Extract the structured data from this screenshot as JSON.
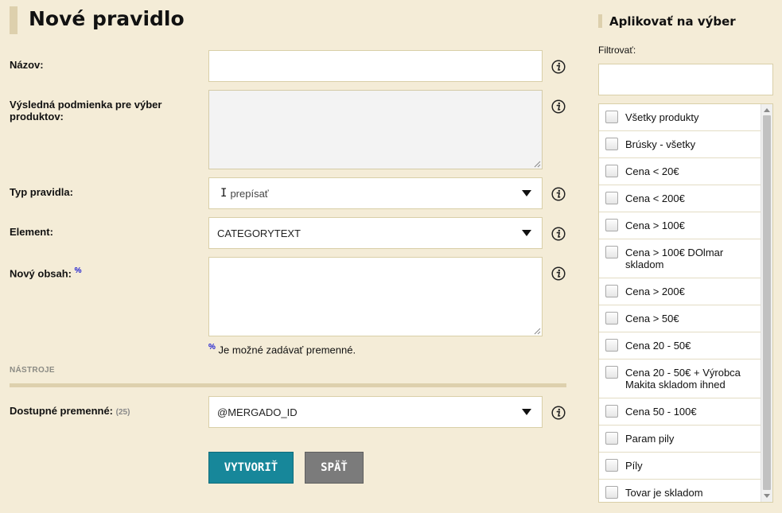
{
  "page": {
    "title": "Nové pravidlo"
  },
  "form": {
    "name_label": "Názov:",
    "condition_label": "Výsledná podmienka pre výber produktov:",
    "type_label": "Typ pravidla:",
    "type_value": "prepísať",
    "element_label": "Element:",
    "element_value": "CATEGORYTEXT",
    "content_label": "Nový obsah:",
    "content_marker": "%",
    "hint_marker": "%",
    "hint_text": "Je možné zadávať premenné.",
    "name_value": "",
    "content_value": ""
  },
  "tools": {
    "section_title": "NÁSTROJE",
    "vars_label": "Dostupné premenné:",
    "vars_count": "(25)",
    "vars_value": "@MERGADO_ID"
  },
  "buttons": {
    "create": "VYTVORIŤ",
    "back": "SPÄŤ"
  },
  "sidebar": {
    "title": "Aplikovať na výber",
    "filter_label": "Filtrovať:",
    "filter_value": "",
    "items": [
      {
        "label": "Všetky produkty"
      },
      {
        "label": "Brúsky - všetky"
      },
      {
        "label": "Cena < 20€"
      },
      {
        "label": "Cena < 200€"
      },
      {
        "label": "Cena > 100€"
      },
      {
        "label": "Cena > 100€ DOlmar skladom"
      },
      {
        "label": "Cena > 200€"
      },
      {
        "label": "Cena > 50€"
      },
      {
        "label": "Cena 20 - 50€"
      },
      {
        "label": "Cena 20 - 50€ + Výrobca Makita skladom ihned"
      },
      {
        "label": "Cena 50 - 100€"
      },
      {
        "label": "Param pily"
      },
      {
        "label": "Píly"
      },
      {
        "label": "Tovar je skladom"
      }
    ]
  },
  "icons": {
    "info": "info-icon",
    "dropdown": "chevron-down-icon",
    "resize": "resize-handle-icon"
  }
}
